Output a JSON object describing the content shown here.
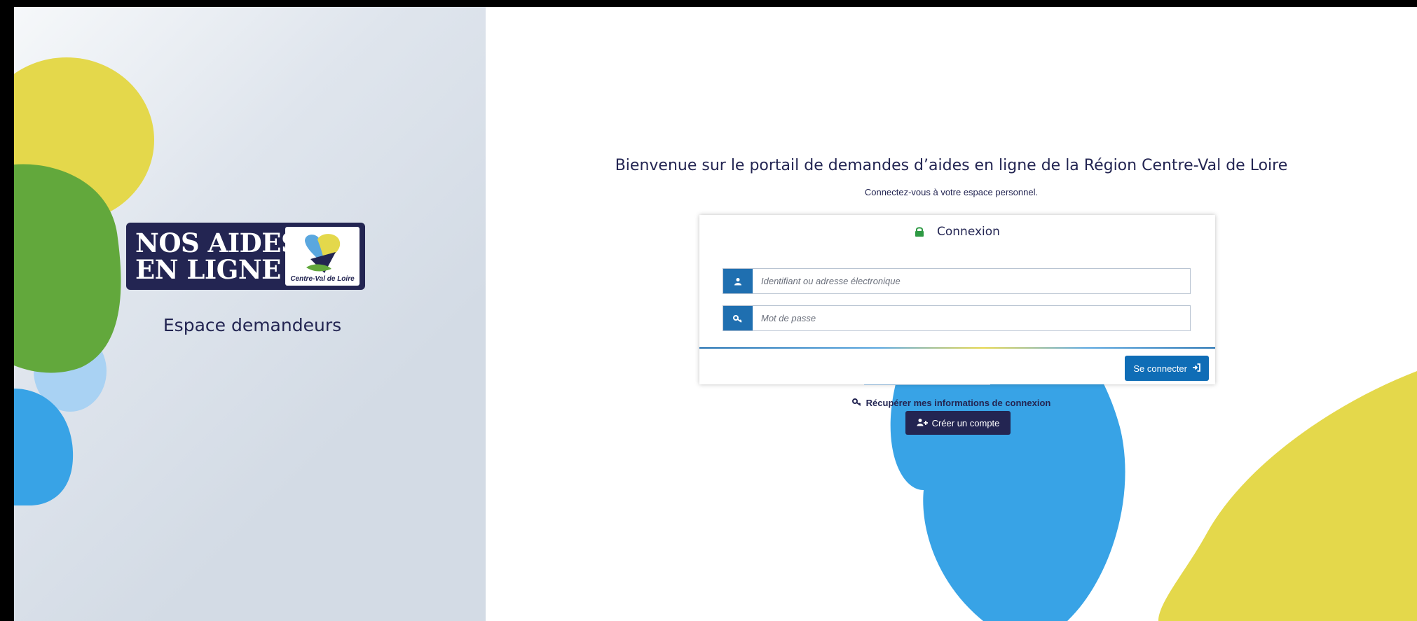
{
  "brand": {
    "logo_line1": "NOS AIDES",
    "logo_line2": "EN LIGNE",
    "logo_badge_text": "Centre-Val de Loire",
    "space_label": "Espace demandeurs"
  },
  "welcome": {
    "title": "Bienvenue sur le portail de demandes d’aides en ligne de la Région Centre-Val de Loire",
    "subtitle": "Connectez-vous à votre espace personnel."
  },
  "login": {
    "title": "Connexion",
    "username_placeholder": "Identifiant ou adresse électronique",
    "password_placeholder": "Mot de passe",
    "submit_label": "Se connecter"
  },
  "links": {
    "recover_label": "Récupérer mes informations de connexion",
    "create_account_label": "Créer un compte"
  },
  "colors": {
    "navy": "#232552",
    "blue": "#38a3e6",
    "light_blue": "#a9d2f3",
    "yellow": "#e4d84b",
    "green": "#62a83c",
    "button_blue": "#0f6db6",
    "lock_green": "#2e9a44"
  },
  "icons": {
    "lock": "lock-icon",
    "user": "user-icon",
    "key": "key-icon",
    "sign_in": "sign-in-icon",
    "user_plus": "user-plus-icon"
  }
}
